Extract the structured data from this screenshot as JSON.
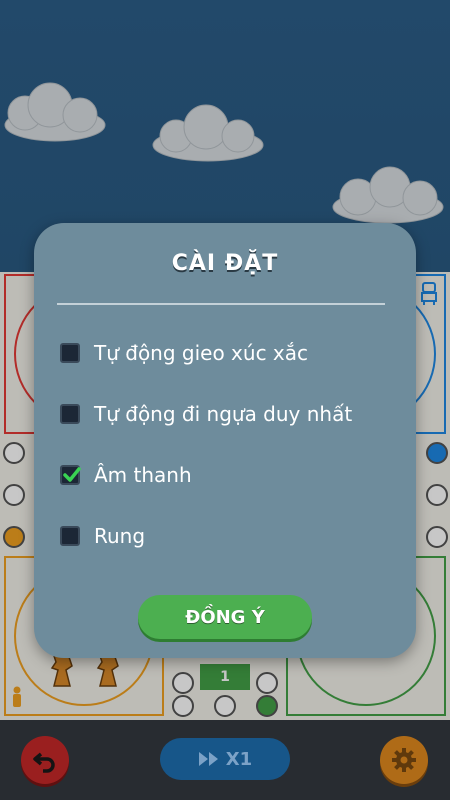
{
  "dialog": {
    "title": "CÀI ĐẶT",
    "options": [
      {
        "label": "Tự động gieo xúc xắc",
        "checked": false
      },
      {
        "label": "Tự động đi ngựa duy nhất",
        "checked": false
      },
      {
        "label": "Âm thanh",
        "checked": true
      },
      {
        "label": "Rung",
        "checked": false
      }
    ],
    "confirm_label": "ĐỒNG Ý"
  },
  "bottom_bar": {
    "speed_label": "X1",
    "icons": [
      "undo-icon",
      "fast-forward-icon",
      "gear-icon"
    ]
  },
  "board": {
    "center_value": "1"
  },
  "colors": {
    "sky": "#2c5e88",
    "dialog_bg": "#6e8c9c",
    "confirm_green": "#4caf50",
    "check_green": "#39d353",
    "undo_red": "#c62828",
    "settings_orange": "#e08a1e",
    "speed_blue": "#1e6fb0"
  }
}
